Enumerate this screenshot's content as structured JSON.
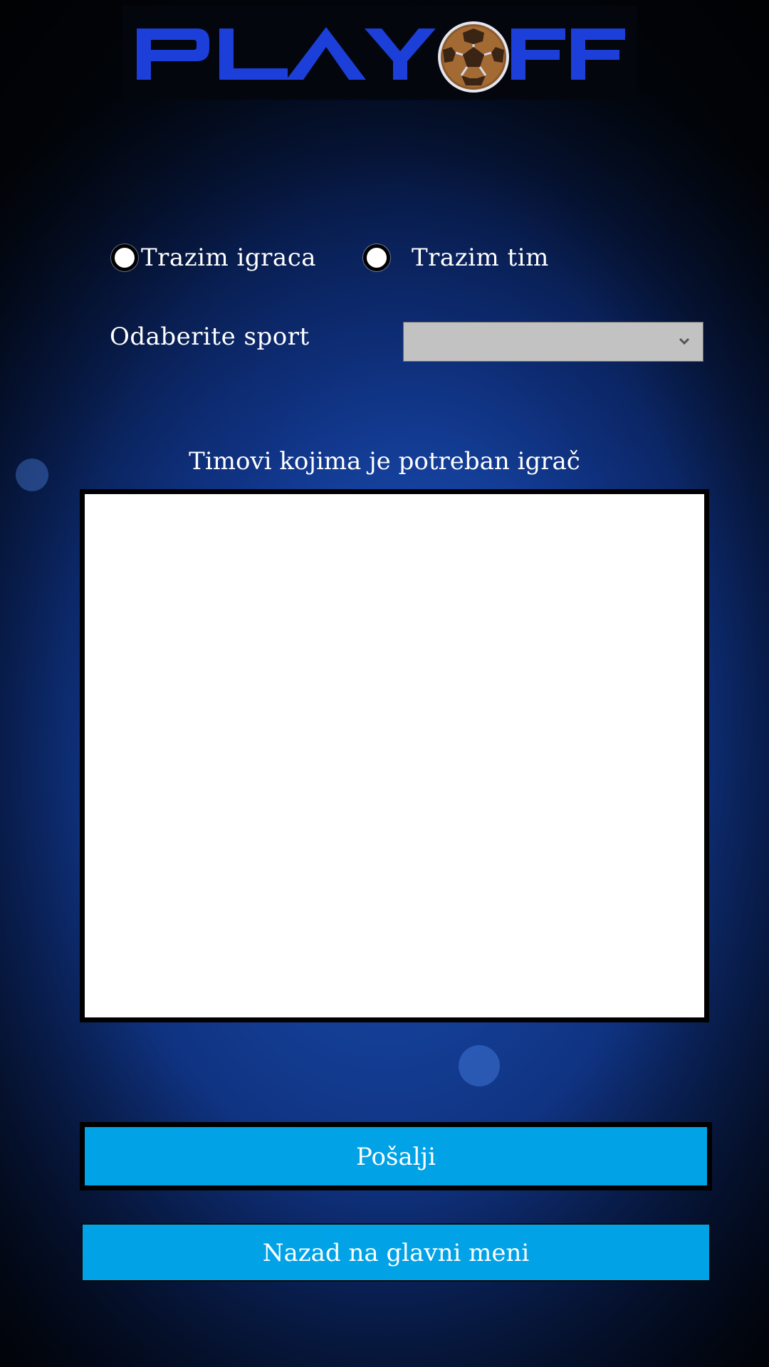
{
  "logo": {
    "text_left": "PLAY",
    "text_right": "FF",
    "ball_icon": "soccer-ball-icon",
    "brand_color": "#1c3fd9"
  },
  "mode": {
    "option_player": "Trazim igraca",
    "option_team": "Trazim tim"
  },
  "sport": {
    "label": "Odaberite sport",
    "selected": ""
  },
  "list": {
    "title": "Timovi kojima je potreban igrač",
    "items": []
  },
  "buttons": {
    "send": "Pošalji",
    "back": "Nazad na glavni meni"
  },
  "colors": {
    "button": "#01a2e6",
    "select": "#c2c2c2"
  }
}
